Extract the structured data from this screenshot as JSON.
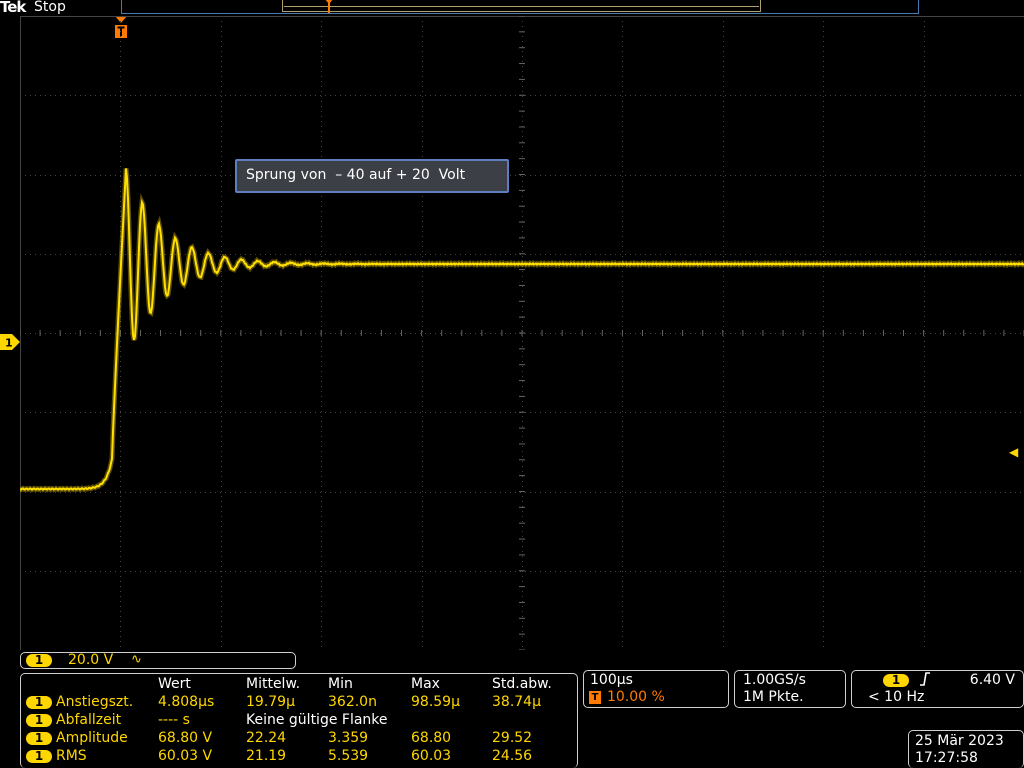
{
  "header": {
    "brand": "Tek",
    "status": "Stop"
  },
  "annotation": {
    "text": "Sprung von  – 40 auf + 20  Volt"
  },
  "channel": {
    "badge": "1",
    "scale": "20.0 V",
    "coupling_icon": "∿",
    "color": "#ffd700"
  },
  "measurements": {
    "headers": [
      "Wert",
      "Mittelw.",
      "Min",
      "Max",
      "Std.abw."
    ],
    "rows": [
      {
        "channel": "1",
        "label": "Anstiegszt.",
        "cells": [
          "4.808µs",
          "19.79µ",
          "362.0n",
          "98.59µ",
          "38.74µ"
        ]
      },
      {
        "channel": "1",
        "label": "Abfallzeit",
        "cells": [
          "---- s",
          "Keine gültige Flanke",
          "",
          "",
          ""
        ]
      },
      {
        "channel": "1",
        "label": "Amplitude",
        "cells": [
          "68.80 V",
          "22.24",
          "3.359",
          "68.80",
          "29.52"
        ]
      },
      {
        "channel": "1",
        "label": "RMS",
        "cells": [
          "60.03 V",
          "21.19",
          "5.539",
          "60.03",
          "24.56"
        ]
      }
    ]
  },
  "horizontal": {
    "timebase": "100µs",
    "trigger_icon": "T",
    "trigger_position": "10.00 %"
  },
  "acquisition": {
    "sample_rate": "1.00GS/s",
    "record_length": "1M Pkte."
  },
  "trigger": {
    "channel": "1",
    "slope_icon": "rising-edge-icon",
    "level": "6.40 V",
    "frequency": "< 10 Hz"
  },
  "datetime": {
    "date": "25 Mär 2023",
    "time": "17:27:58"
  },
  "colors": {
    "trace": "#ffd700",
    "trigger": "#ff7a00",
    "frame": "#cfcfcf",
    "record_bar": "#4a78b0"
  }
}
